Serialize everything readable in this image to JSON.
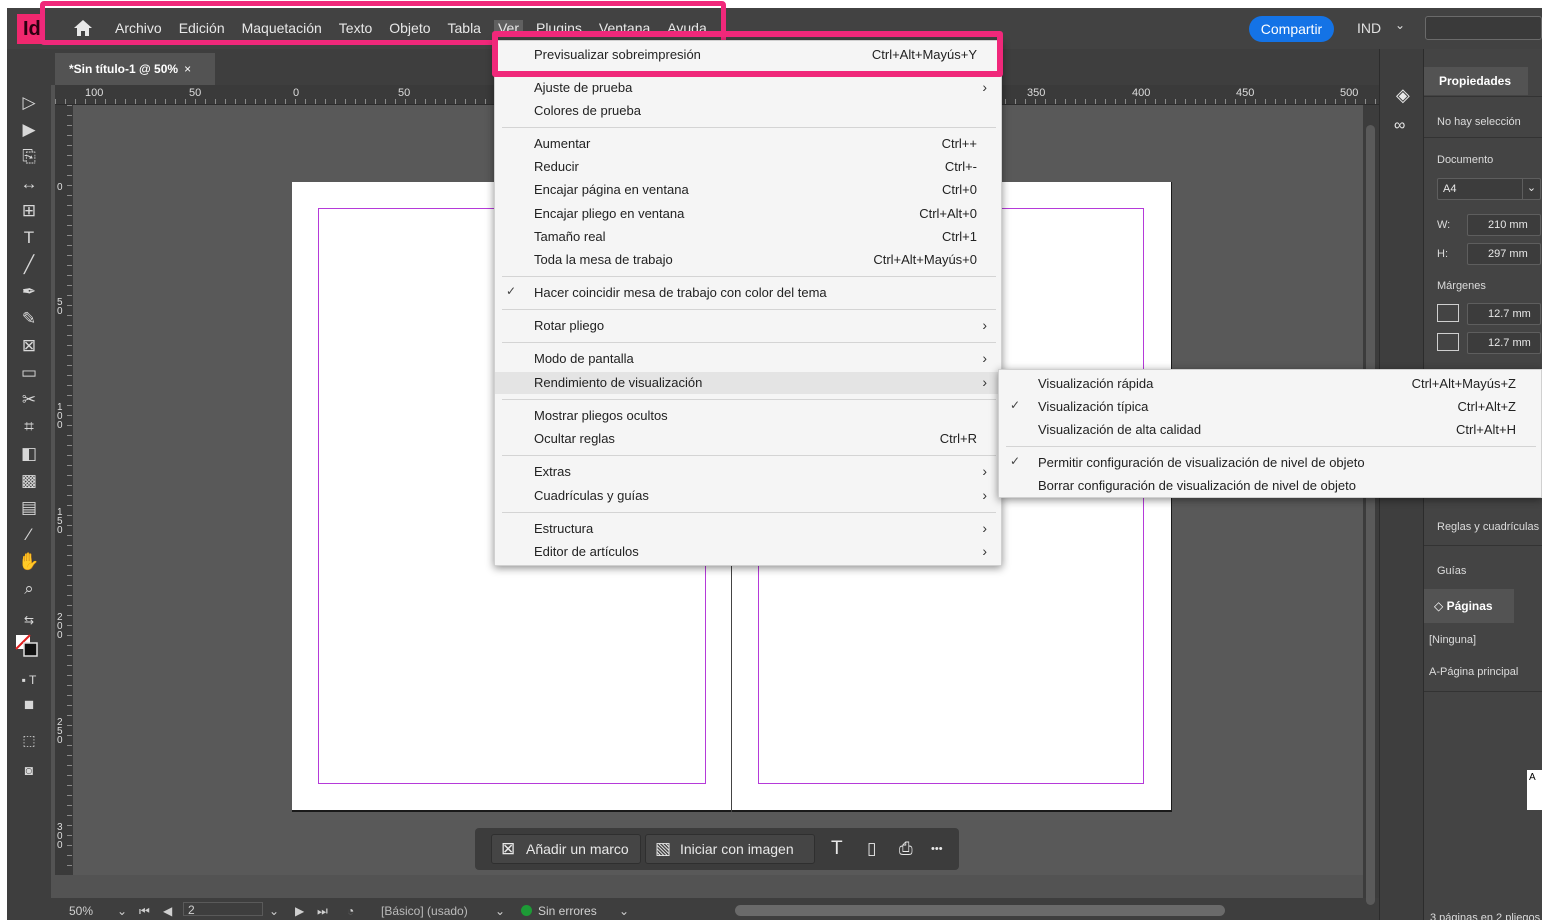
{
  "app": {
    "logo_text": "Id",
    "accent": "#f0286e"
  },
  "menubar": {
    "items": [
      "Archivo",
      "Edición",
      "Maquetación",
      "Texto",
      "Objeto",
      "Tabla",
      "Ver",
      "Plugins",
      "Ventana",
      "Ayuda"
    ],
    "active": "Ver",
    "share_label": "Compartir",
    "lang": "IND"
  },
  "document_tab": {
    "title": "*Sin título-1 @ 50%",
    "close": "×"
  },
  "ruler_h": [
    "100",
    "50",
    "0",
    "50",
    "350",
    "400",
    "450",
    "500"
  ],
  "ruler_v": [
    "0",
    "50",
    "100",
    "150",
    "200",
    "250",
    "300"
  ],
  "view_menu": {
    "items": [
      {
        "label": "Previsualizar sobreimpresión",
        "shortcut": "Ctrl+Alt+Mayús+Y"
      },
      {
        "label": "Ajuste de prueba",
        "submenu": true
      },
      {
        "label": "Colores de prueba"
      },
      {
        "label": "Aumentar",
        "shortcut": "Ctrl++"
      },
      {
        "label": "Reducir",
        "shortcut": "Ctrl+-"
      },
      {
        "label": "Encajar página en ventana",
        "shortcut": "Ctrl+0"
      },
      {
        "label": "Encajar pliego en ventana",
        "shortcut": "Ctrl+Alt+0"
      },
      {
        "label": "Tamaño real",
        "shortcut": "Ctrl+1"
      },
      {
        "label": "Toda la mesa de trabajo",
        "shortcut": "Ctrl+Alt+Mayús+0"
      },
      {
        "label": "Hacer coincidir mesa de trabajo con color del tema",
        "checked": true
      },
      {
        "label": "Rotar pliego",
        "submenu": true
      },
      {
        "label": "Modo de pantalla",
        "submenu": true
      },
      {
        "label": "Rendimiento de visualización",
        "submenu": true
      },
      {
        "label": "Mostrar pliegos ocultos"
      },
      {
        "label": "Ocultar reglas",
        "shortcut": "Ctrl+R"
      },
      {
        "label": "Extras",
        "submenu": true
      },
      {
        "label": "Cuadrículas y guías",
        "submenu": true
      },
      {
        "label": "Estructura",
        "submenu": true
      },
      {
        "label": "Editor de artículos",
        "submenu": true
      }
    ],
    "submenu_arrow": "›",
    "check_mark": "✓"
  },
  "display_submenu": {
    "items": [
      {
        "label": "Visualización rápida",
        "shortcut": "Ctrl+Alt+Mayús+Z"
      },
      {
        "label": "Visualización típica",
        "shortcut": "Ctrl+Alt+Z",
        "checked": true
      },
      {
        "label": "Visualización de alta calidad",
        "shortcut": "Ctrl+Alt+H"
      },
      {
        "label": "Permitir configuración de visualización de nivel de objeto",
        "checked": true
      },
      {
        "label": "Borrar configuración de visualización de nivel de objeto"
      }
    ]
  },
  "context_bar": {
    "add_frame": "Añadir un marco",
    "start_image": "Iniciar con imagen",
    "more": "•••"
  },
  "statusbar": {
    "zoom": "50%",
    "page": "2",
    "style": "[Básico] (usado)",
    "errors": "Sin errores"
  },
  "properties": {
    "tab": "Propiedades",
    "no_selection": "No hay selección",
    "document": "Documento",
    "size": "A4",
    "w_label": "W:",
    "w_value": "210 mm",
    "h_label": "H:",
    "h_value": "297 mm",
    "margins": "Márgenes",
    "margin_top": "12.7 mm",
    "margin_bottom": "12.7 mm",
    "rulers_grids": "Reglas y cuadrículas",
    "guides": "Guías",
    "pages_tab": "Páginas",
    "none": "[Ninguna]",
    "master": "A-Página principal",
    "master_thumb": "A",
    "pages_count": "3 páginas en 2 pliegos"
  }
}
